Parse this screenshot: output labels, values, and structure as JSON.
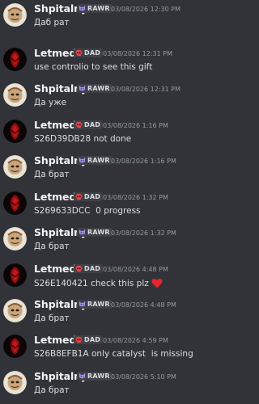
{
  "users": {
    "shpitalny": {
      "name": "Shpitalny",
      "tag": "RAWR",
      "tag_icon": "cat-icon",
      "avatar": "cartoon-face-avatar"
    },
    "letmedie": {
      "name": "Letmedie",
      "tag": "DAD",
      "tag_icon": "red-skull-icon",
      "avatar": "red-hooded-figure-avatar"
    }
  },
  "messages": [
    {
      "author": "Shpitalny",
      "tag": "RAWR",
      "time": "03/08/2026 12:30 PM",
      "text": "Даб рат"
    },
    {
      "author": "Letmedie",
      "tag": "DAD",
      "time": "03/08/2026 12:31 PM",
      "text": "use controlio to see this gift"
    },
    {
      "author": "Shpitalny",
      "tag": "RAWR",
      "time": "03/08/2026 12:31 PM",
      "text": "Да уже"
    },
    {
      "author": "Letmedie",
      "tag": "DAD",
      "time": "03/08/2026 1:16 PM",
      "text": "S26D39DB28 not done"
    },
    {
      "author": "Shpitalny",
      "tag": "RAWR",
      "time": "03/08/2026 1:16 PM",
      "text": "Да брат"
    },
    {
      "author": "Letmedie",
      "tag": "DAD",
      "time": "03/08/2026 1:32 PM",
      "text": "S269633DCC  0 progress"
    },
    {
      "author": "Shpitalny",
      "tag": "RAWR",
      "time": "03/08/2026 1:32 PM",
      "text": "Да брат"
    },
    {
      "author": "Letmedie",
      "tag": "DAD",
      "time": "03/08/2026 4:48 PM",
      "text": "S26E140421 check this plz",
      "emoji": "heart-icon"
    },
    {
      "author": "Shpitalny",
      "tag": "RAWR",
      "time": "03/08/2026 4:48 PM",
      "text": "Да брат"
    },
    {
      "author": "Letmedie",
      "tag": "DAD",
      "time": "03/08/2026 4:59 PM",
      "text": "S26B8EFB1A only catalyst  is missing"
    },
    {
      "author": "Shpitalny",
      "tag": "RAWR",
      "time": "03/08/2026 5:10 PM",
      "text": "Да брат"
    }
  ],
  "colors": {
    "background": "#313338",
    "username": "#f2f3f5",
    "message_text": "#dbdee1",
    "timestamp": "#949ba4",
    "tag_bg": "#3f4147",
    "heart": "#e5242b"
  }
}
